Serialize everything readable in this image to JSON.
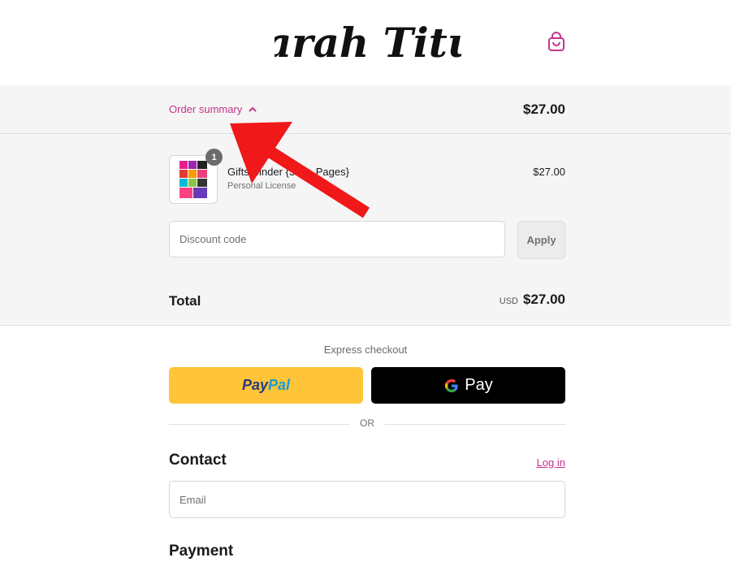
{
  "header": {
    "logo_text": "Sarah Titus",
    "cart_icon": "shopping-bag-icon"
  },
  "summary_bar": {
    "toggle_label": "Order summary",
    "toggle_icon": "chevron-up-icon",
    "total": "$27.00"
  },
  "line_item": {
    "quantity": "1",
    "name": "Gifts Binder {300+ Pages}",
    "variant": "Personal License",
    "price": "$27.00"
  },
  "discount": {
    "placeholder": "Discount code",
    "apply_label": "Apply"
  },
  "totals": {
    "label": "Total",
    "currency": "USD",
    "value": "$27.00"
  },
  "express": {
    "label": "Express checkout",
    "paypal_part1": "Pay",
    "paypal_part2": "Pal",
    "gpay_label": "Pay",
    "separator": "OR"
  },
  "contact": {
    "heading": "Contact",
    "login_label": "Log in",
    "email_placeholder": "Email"
  },
  "payment": {
    "heading": "Payment"
  },
  "colors": {
    "accent": "#c4338c",
    "paypal_yellow": "#ffc439",
    "annotation_red": "#f01818"
  }
}
